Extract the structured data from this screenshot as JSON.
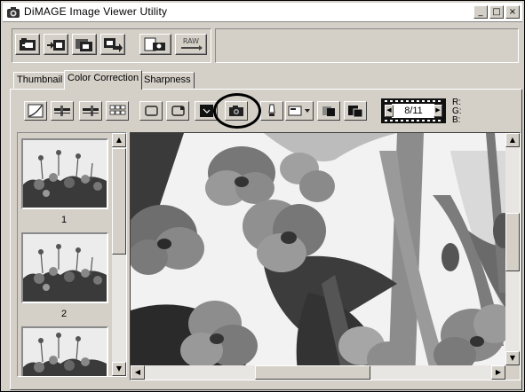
{
  "window": {
    "title": "DiMAGE Image Viewer Utility",
    "minimize": "_",
    "maximize": "□",
    "close": "×"
  },
  "toolbar": {
    "raw_label": "RAW"
  },
  "tabs": [
    {
      "label": "Thumbnail",
      "active": false
    },
    {
      "label": "Color Correction",
      "active": true
    },
    {
      "label": "Sharpness",
      "active": false
    }
  ],
  "frame_counter": {
    "text": "8/11"
  },
  "rgb_readout": {
    "r": "R:",
    "g": "G:",
    "b": "B:"
  },
  "thumbnails": [
    {
      "number": "1"
    },
    {
      "number": "2"
    }
  ],
  "icons": {
    "tools": [
      "curve-icon",
      "levels-icon",
      "levels-2-icon",
      "grid-icon",
      "crop-icon",
      "rotate-icon",
      "contrast-icon",
      "camera-icon",
      "lamp-icon",
      "dropdown-icon",
      "square-icon",
      "square-2-icon"
    ]
  }
}
